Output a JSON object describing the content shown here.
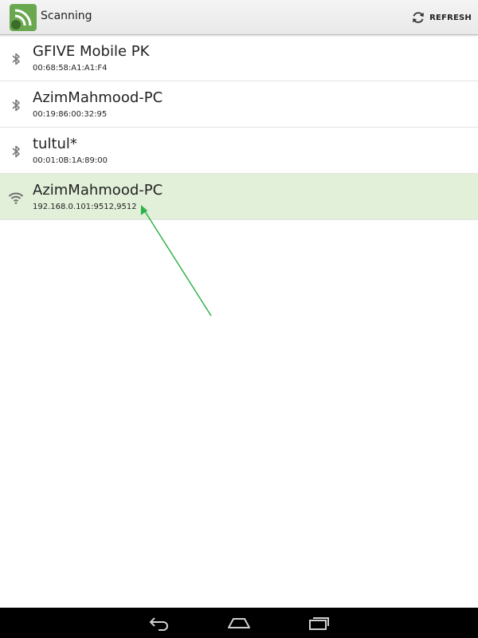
{
  "header": {
    "title": "Scanning",
    "refresh_label": "REFRESH",
    "app_icon": "rss-cast-icon",
    "refresh_icon": "refresh-icon"
  },
  "devices": [
    {
      "name": "GFIVE Mobile PK",
      "address": "00:68:58:A1:A1:F4",
      "type": "bluetooth",
      "selected": false
    },
    {
      "name": "AzimMahmood-PC",
      "address": "00:19:86:00:32:95",
      "type": "bluetooth",
      "selected": false
    },
    {
      "name": "tultul*",
      "address": "00:01:0B:1A:89:00",
      "type": "bluetooth",
      "selected": false
    },
    {
      "name": "AzimMahmood-PC",
      "address": "192.168.0.101:9512,9512",
      "type": "wifi",
      "selected": true
    }
  ],
  "nav": {
    "buttons": [
      "back-icon",
      "home-icon",
      "recent-apps-icon"
    ]
  },
  "colors": {
    "selected_row": "#e2efd9",
    "accent_green": "#6aa84f",
    "annotation_arrow": "#2db34a"
  }
}
